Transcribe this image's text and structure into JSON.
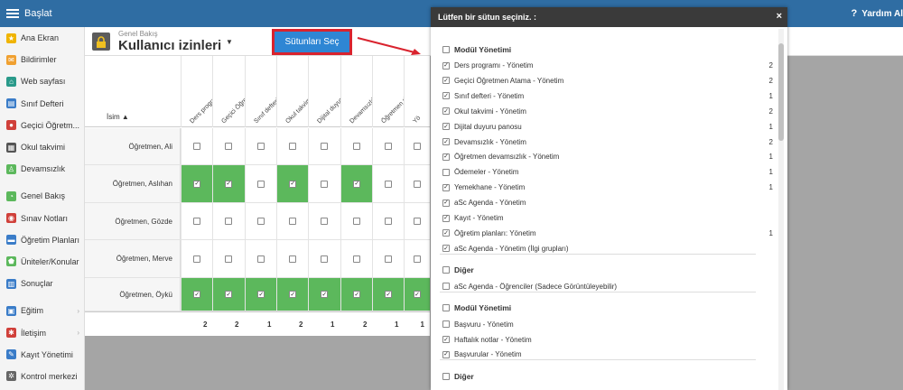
{
  "topbar": {
    "title": "Başlat",
    "help": "Yardım Al"
  },
  "sidebar": {
    "items": [
      {
        "label": "Ana Ekran",
        "icon": "star-icon",
        "color": "#f0b400"
      },
      {
        "label": "Bildirimler",
        "icon": "envelope-icon",
        "color": "#f0a030"
      },
      {
        "label": "Web sayfası",
        "icon": "home-icon",
        "color": "#2a9a8a"
      },
      {
        "label": "Sınıf Defteri",
        "icon": "book-icon",
        "color": "#3a7cc8"
      },
      {
        "label": "Geçici Öğretm...",
        "icon": "person-icon",
        "color": "#d0403a"
      },
      {
        "label": "Okul takvimi",
        "icon": "calendar-icon",
        "color": "#555555"
      },
      {
        "label": "Devamsızlık",
        "icon": "user-outline-icon",
        "color": "#5cb85c"
      },
      {
        "label": "Genel Bakış",
        "icon": "pie-icon",
        "color": "#5cb85c"
      },
      {
        "label": "Sınav Notları",
        "icon": "grade-icon",
        "color": "#d0403a"
      },
      {
        "label": "Öğretim Planları",
        "icon": "plan-icon",
        "color": "#3a7cc8"
      },
      {
        "label": "Üniteler/Konular",
        "icon": "shield-icon",
        "color": "#5cb85c"
      },
      {
        "label": "Sonuçlar",
        "icon": "bar-chart-icon",
        "color": "#3a7cc8"
      },
      {
        "label": "Eğitim",
        "icon": "education-icon",
        "color": "#3a7cc8"
      },
      {
        "label": "İletişim",
        "icon": "chat-icon",
        "color": "#d0403a"
      },
      {
        "label": "Kayıt Yönetimi",
        "icon": "pen-icon",
        "color": "#3a7cc8"
      },
      {
        "label": "Kontrol merkezi",
        "icon": "gear-icon",
        "color": "#666666"
      }
    ]
  },
  "header": {
    "subtitle": "Genel Bakış",
    "title": "Kullanıcı izinleri",
    "columns_button": "Sütunları Seç"
  },
  "grid": {
    "name_header": "İsim ▲",
    "columns": [
      "Ders programı - Yönetim",
      "Geçici Öğretmen Atama - Yönetim",
      "Sınıf defteri - Yönetim",
      "Okul takvimi - Yönetim",
      "Dijital duyuru panosu",
      "Devamsızlık - Yönetim",
      "Öğretmen devamsızlık - Yönetim",
      "Yö"
    ],
    "rows": [
      {
        "name": "Öğretmen, Ali",
        "checks": [
          false,
          false,
          false,
          false,
          false,
          false,
          false,
          false
        ]
      },
      {
        "name": "Öğretmen, Aslıhan",
        "checks": [
          true,
          true,
          false,
          true,
          false,
          true,
          false,
          false
        ]
      },
      {
        "name": "Öğretmen, Gözde",
        "checks": [
          false,
          false,
          false,
          false,
          false,
          false,
          false,
          false
        ]
      },
      {
        "name": "Öğretmen, Merve",
        "checks": [
          false,
          false,
          false,
          false,
          false,
          false,
          false,
          false
        ]
      },
      {
        "name": "Öğretmen, Öykü",
        "checks": [
          true,
          true,
          true,
          true,
          true,
          true,
          true,
          true
        ]
      }
    ],
    "totals": [
      "2",
      "2",
      "1",
      "2",
      "1",
      "2",
      "1",
      "1"
    ]
  },
  "modal": {
    "title": "Lütfen bir sütun seçiniz. :",
    "close": "×",
    "entries": [
      {
        "type": "group",
        "label": "Modül Yönetimi",
        "checked": false
      },
      {
        "type": "item",
        "label": "Ders programı - Yönetim",
        "checked": true,
        "count": "2"
      },
      {
        "type": "item",
        "label": "Geçici Öğretmen Atama - Yönetim",
        "checked": true,
        "count": "2"
      },
      {
        "type": "item",
        "label": "Sınıf defteri - Yönetim",
        "checked": true,
        "count": "1"
      },
      {
        "type": "item",
        "label": "Okul takvimi - Yönetim",
        "checked": true,
        "count": "2"
      },
      {
        "type": "item",
        "label": "Dijital duyuru panosu",
        "checked": true,
        "count": "1"
      },
      {
        "type": "item",
        "label": "Devamsızlık - Yönetim",
        "checked": true,
        "count": "2"
      },
      {
        "type": "item",
        "label": "Öğretmen devamsızlık - Yönetim",
        "checked": true,
        "count": "1"
      },
      {
        "type": "item",
        "label": "Ödemeler - Yönetim",
        "checked": false,
        "count": "1"
      },
      {
        "type": "item",
        "label": "Yemekhane - Yönetim",
        "checked": true,
        "count": "1"
      },
      {
        "type": "item",
        "label": "aSc Agenda - Yönetim",
        "checked": true,
        "count": ""
      },
      {
        "type": "item",
        "label": "Kayıt - Yönetim",
        "checked": true,
        "count": ""
      },
      {
        "type": "item",
        "label": "Öğretim planları: Yönetim",
        "checked": true,
        "count": "1"
      },
      {
        "type": "item",
        "label": "aSc Agenda - Yönetim (İlgi grupları)",
        "checked": true,
        "count": ""
      },
      {
        "type": "group",
        "label": "Diğer",
        "checked": false
      },
      {
        "type": "item",
        "label": "aSc Agenda - Öğrenciler (Sadece Görüntüleyebilir)",
        "checked": false,
        "count": ""
      },
      {
        "type": "group",
        "label": "Modül Yönetimi",
        "checked": false
      },
      {
        "type": "item",
        "label": "Başvuru - Yönetim",
        "checked": false,
        "count": ""
      },
      {
        "type": "item",
        "label": "Haftalık notlar - Yönetim",
        "checked": true,
        "count": ""
      },
      {
        "type": "item",
        "label": "Başvurular - Yönetim",
        "checked": true,
        "count": ""
      },
      {
        "type": "group",
        "label": "Diğer",
        "checked": false
      }
    ]
  },
  "colors": {
    "topbar": "#2f6da3",
    "checked_cell": "#5cb85c",
    "highlight": "#d9232e",
    "button": "#2e86d4"
  }
}
